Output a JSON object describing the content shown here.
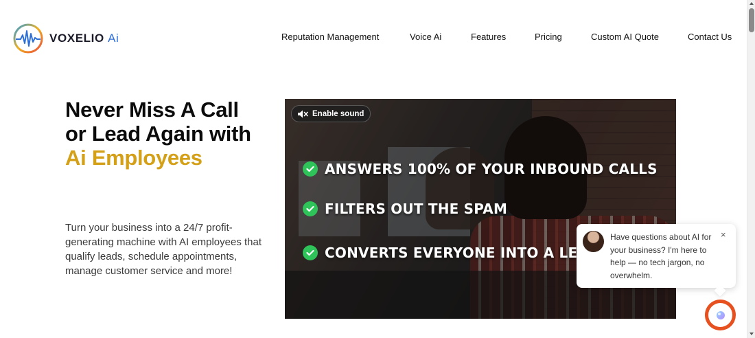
{
  "brand": {
    "name": "VOXELIO",
    "suffix": "Ai",
    "logo_icon": "waveform-circle-icon",
    "colors": {
      "accent_gold": "#d4a017",
      "logo_blue": "#2d6fd6",
      "check_green": "#2ec45a",
      "launcher_orange": "#e7501f"
    }
  },
  "nav": {
    "items": [
      {
        "label": "Reputation Management"
      },
      {
        "label": "Voice Ai"
      },
      {
        "label": "Features"
      },
      {
        "label": "Pricing"
      },
      {
        "label": "Custom AI Quote"
      },
      {
        "label": "Contact Us"
      }
    ]
  },
  "hero": {
    "title_line1": "Never Miss A Call",
    "title_line2": "or Lead Again with",
    "title_accent": "Ai Employees",
    "subtitle": "Turn your business into a 24/7 profit-generating machine with AI employees that qualify leads, schedule appointments, manage customer service and more!"
  },
  "video": {
    "sound_button_label": "Enable sound",
    "sound_icon": "muted-speaker-icon",
    "bullets": [
      {
        "text": "ANSWERS 100% OF YOUR INBOUND CALLS",
        "icon": "check-circle-icon"
      },
      {
        "text": "FILTERS OUT THE SPAM",
        "icon": "check-circle-icon"
      },
      {
        "text": "CONVERTS EVERYONE INTO A LEA",
        "icon": "check-circle-icon"
      }
    ]
  },
  "chat": {
    "message": "Have questions about AI for your business? I'm here to help — no tech jargon, no overwhelm.",
    "close_glyph": "×",
    "close_icon": "close-icon",
    "launcher_icon": "chat-bubble-icon"
  }
}
